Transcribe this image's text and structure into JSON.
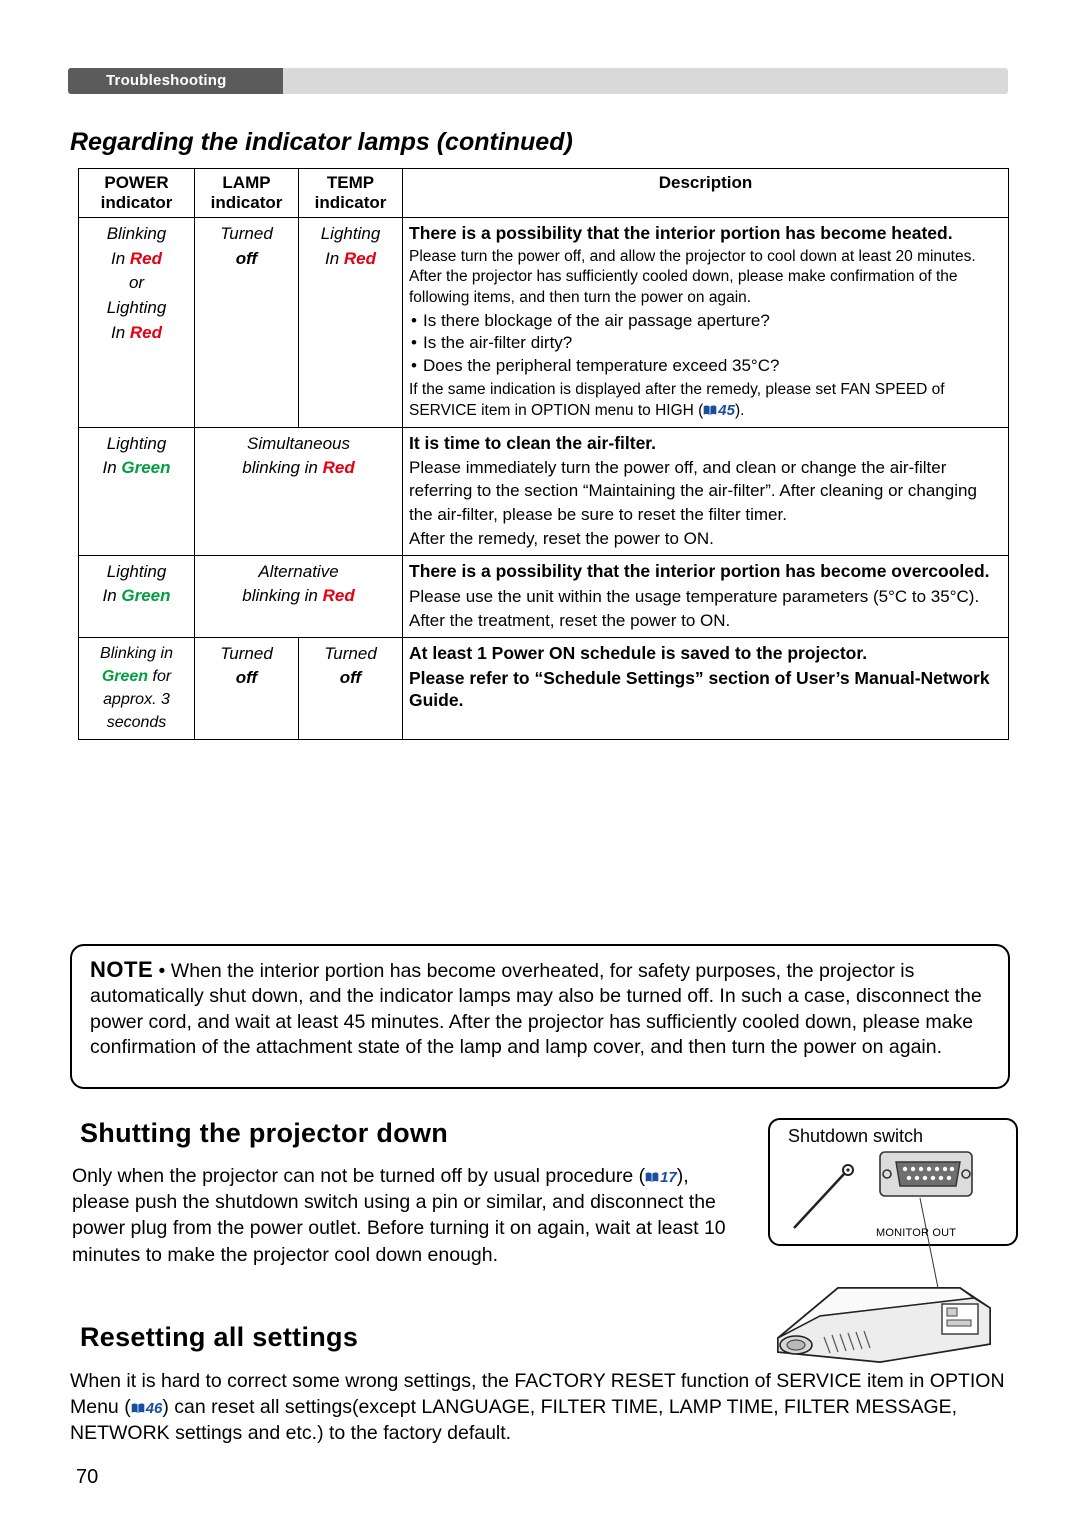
{
  "header": {
    "breadcrumb": "Troubleshooting"
  },
  "section_title": "Regarding the indicator lamps (continued)",
  "table": {
    "headers": {
      "power_l1": "POWER",
      "power_l2": "indicator",
      "lamp_l1": "LAMP",
      "lamp_l2": "indicator",
      "temp_l1": "TEMP",
      "temp_l2": "indicator",
      "description": "Description"
    },
    "rows": [
      {
        "power": [
          "Blinking",
          "In Red",
          "or",
          "Lighting",
          "In Red"
        ],
        "lamp": [
          "Turned",
          "off"
        ],
        "temp": [
          "Lighting",
          "In Red"
        ],
        "heading": "There is a possibility that the interior portion has become heated.",
        "body1": "Please turn the power off, and allow the projector to cool down at least 20 minutes. After the projector has sufficiently cooled down, please make confirmation of the following items, and then turn the power on again.",
        "bullets": [
          "Is there blockage of the air passage aperture?",
          "Is the air-filter dirty?",
          "Does the peripheral temperature exceed 35°C?"
        ],
        "body2": "If the same indication is displayed after the remedy, please set FAN SPEED of SERVICE item in OPTION menu to HIGH (",
        "body2_ref": "45",
        "body2_tail": ")."
      },
      {
        "power": [
          "Lighting",
          "In Green"
        ],
        "lamp": [
          "Simultaneous",
          "blinking in Red"
        ],
        "temp": [],
        "heading": "It is time to clean the air-filter.",
        "body1": "Please immediately turn the power off, and clean or change the air-filter referring to the section “Maintaining the air-filter”. After cleaning or changing the air-filter, please be sure to reset the filter timer.",
        "body2": "After the remedy, reset the power to ON."
      },
      {
        "power": [
          "Lighting",
          "In Green"
        ],
        "lamp": [
          "Alternative",
          "blinking in Red"
        ],
        "temp": [],
        "heading": "There is a possibility that the interior portion has become overcooled.",
        "body1": "Please use the unit within the usage temperature parameters (5°C to 35°C).",
        "body2": "After the treatment, reset the power to ON."
      },
      {
        "power": [
          "Blinking in",
          "Green for",
          "approx. 3",
          "seconds"
        ],
        "lamp": [
          "Turned",
          "off"
        ],
        "temp": [
          "Turned",
          "off"
        ],
        "heading": "At least 1 Power ON schedule is saved to the projector.",
        "body1": "Please refer to “Schedule Settings” section of User’s Manual-Network Guide."
      }
    ]
  },
  "note": {
    "label": "NOTE",
    "text": "• When the interior portion has become overheated, for safety purposes, the projector is automatically shut down, and the indicator lamps may also be turned off. In such a case, disconnect the power cord, and wait at least 45 minutes. After the projector has sufficiently cooled down, please make confirmation of the attachment state of the lamp and lamp cover, and then turn the power on again."
  },
  "shutting": {
    "heading": "Shutting the projector down",
    "text_a": "Only when the projector can not be turned off by usual procedure (",
    "ref": "17",
    "text_b": "), please push the shutdown switch using a pin or similar, and disconnect the power plug from the power outlet. Before turning it on again, wait at least 10 minutes to make the projector cool down enough.",
    "illustration": {
      "caption": "Shutdown switch",
      "port_label": "MONITOR OUT"
    }
  },
  "resetting": {
    "heading": "Resetting all settings",
    "text_a": "When it is hard to correct some wrong settings, the FACTORY RESET function of SERVICE item in OPTION Menu (",
    "ref": "46",
    "text_b": ") can reset all settings(except LANGUAGE, FILTER TIME, LAMP TIME, FILTER MESSAGE, NETWORK settings and etc.) to the factory default."
  },
  "page_number": "70"
}
